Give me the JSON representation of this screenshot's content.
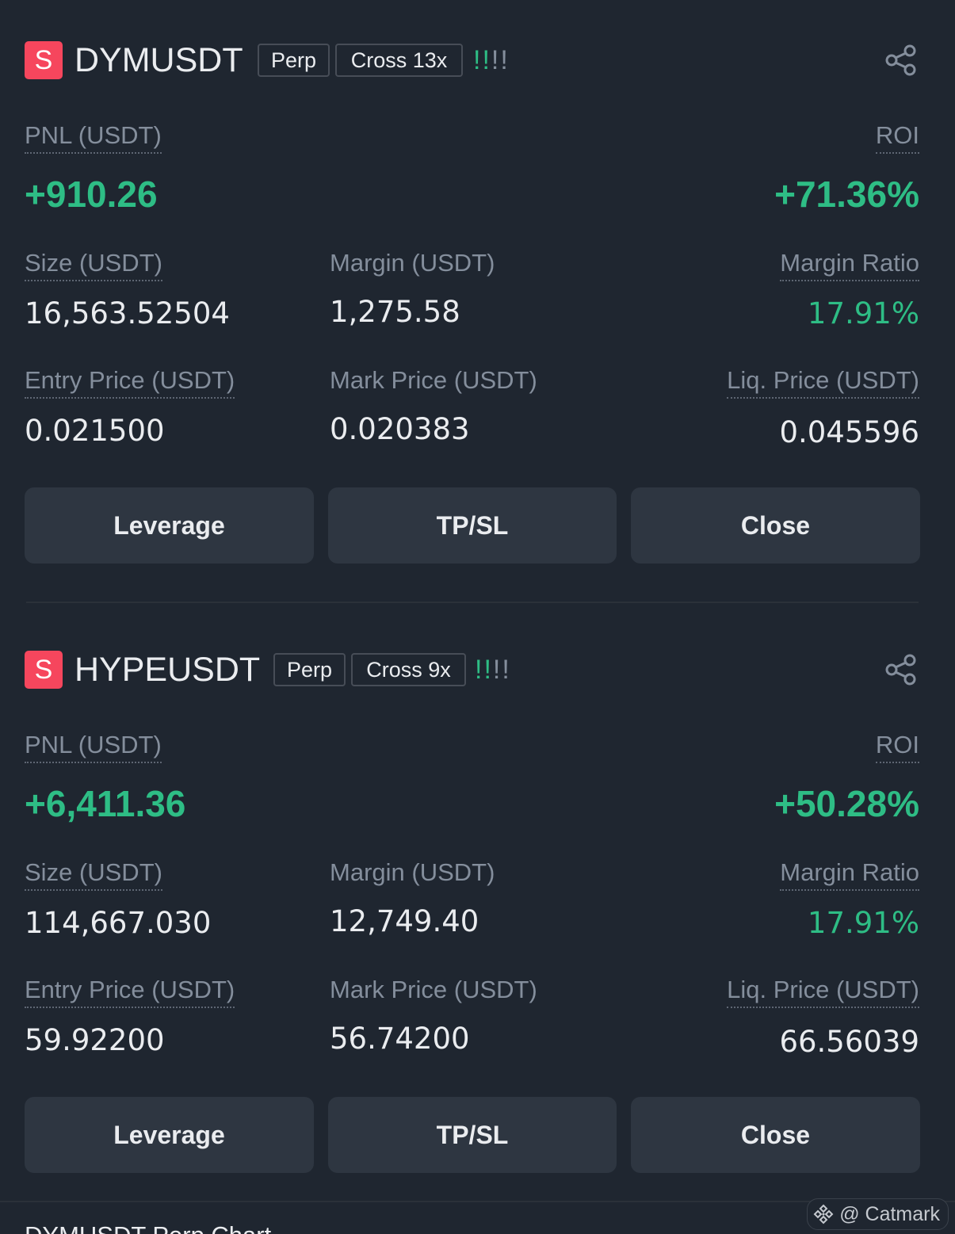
{
  "positions": [
    {
      "side": "S",
      "symbol": "DYMUSDT",
      "type": "Perp",
      "margin_mode": "Cross 13x",
      "risk_on": "!!",
      "risk_off": "!!",
      "pnl_label": "PNL (USDT)",
      "pnl": "+910.26",
      "roi_label": "ROI",
      "roi": "+71.36%",
      "size_label": "Size (USDT)",
      "size": "16,563.52504",
      "margin_label": "Margin (USDT)",
      "margin": "1,275.58",
      "margin_ratio_label": "Margin Ratio",
      "margin_ratio": "17.91%",
      "entry_label": "Entry Price (USDT)",
      "entry": "0.021500",
      "mark_label": "Mark Price (USDT)",
      "mark": "0.020383",
      "liq_label": "Liq. Price (USDT)",
      "liq": "0.045596",
      "buttons": {
        "leverage": "Leverage",
        "tpsl": "TP/SL",
        "close": "Close"
      }
    },
    {
      "side": "S",
      "symbol": "HYPEUSDT",
      "type": "Perp",
      "margin_mode": "Cross 9x",
      "risk_on": "!!",
      "risk_off": "!!",
      "pnl_label": "PNL (USDT)",
      "pnl": "+6,411.36",
      "roi_label": "ROI",
      "roi": "+50.28%",
      "size_label": "Size (USDT)",
      "size": "114,667.030",
      "margin_label": "Margin (USDT)",
      "margin": "12,749.40",
      "margin_ratio_label": "Margin Ratio",
      "margin_ratio": "17.91%",
      "entry_label": "Entry Price (USDT)",
      "entry": "59.92200",
      "mark_label": "Mark Price (USDT)",
      "mark": "56.74200",
      "liq_label": "Liq. Price (USDT)",
      "liq": "66.56039",
      "buttons": {
        "leverage": "Leverage",
        "tpsl": "TP/SL",
        "close": "Close"
      }
    }
  ],
  "chart_title": "DYMUSDT Perp Chart",
  "watermark": "@ Catmark",
  "icons": {
    "share": "share-icon",
    "watermark": "binance-diamond-icon"
  },
  "colors": {
    "background": "#1f2630",
    "green": "#2ebd85",
    "short_red": "#f6465d",
    "button": "#2e3641"
  }
}
